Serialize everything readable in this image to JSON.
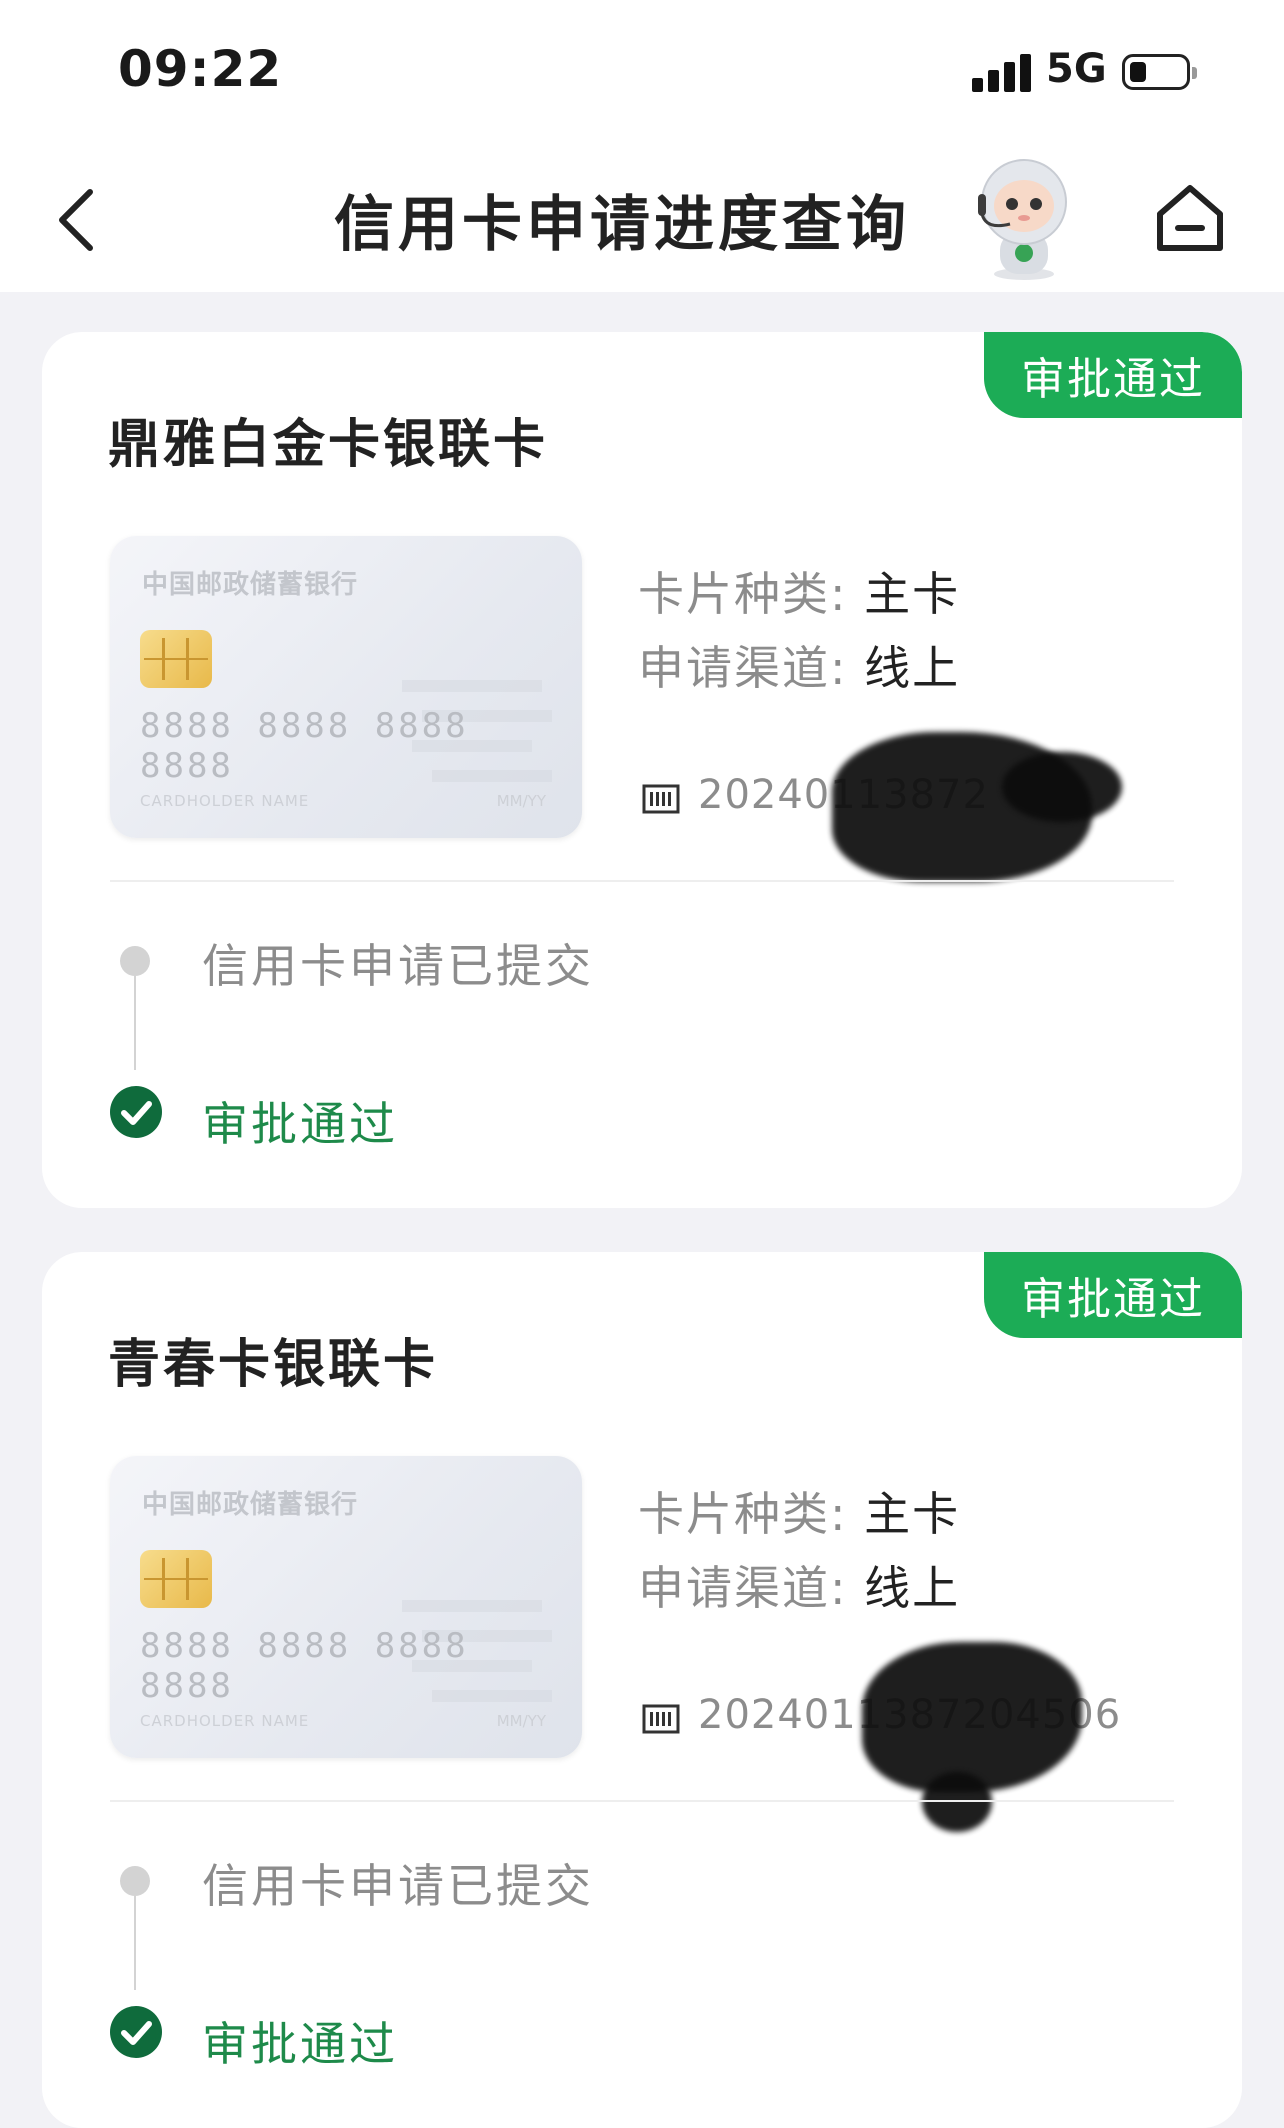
{
  "status_bar": {
    "time": "09:22",
    "network": "5G"
  },
  "nav": {
    "title": "信用卡申请进度查询"
  },
  "labels": {
    "card_type_label": "卡片种类:",
    "channel_label": "申请渠道:"
  },
  "card_face": {
    "bank": "中国邮政储蓄银行",
    "number": "8888 8888 8888 8888",
    "holder": "CARDHOLDER NAME",
    "expiry": "MM/YY"
  },
  "applications": [
    {
      "status": "审批通过",
      "name": "鼎雅白金卡银联卡",
      "card_type": "主卡",
      "channel": "线上",
      "app_no_visible": "20240113872",
      "steps": [
        "信用卡申请已提交",
        "审批通过"
      ]
    },
    {
      "status": "审批通过",
      "name": "青春卡银联卡",
      "card_type": "主卡",
      "channel": "线上",
      "app_no_visible": "2024011387204506",
      "steps": [
        "信用卡申请已提交",
        "审批通过"
      ]
    }
  ],
  "icons": {
    "back": "chevron-left-icon",
    "home": "home-icon",
    "avatar": "robot-assistant-avatar",
    "app_no": "barcode-icon",
    "step_done": "check-circle-icon"
  },
  "colors": {
    "accent_green": "#1cac56",
    "step_green": "#1e8a4a",
    "dark_green_check": "#0f6b3c"
  }
}
